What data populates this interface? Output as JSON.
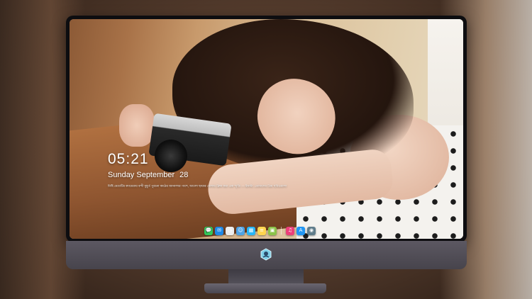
{
  "lockscreen": {
    "time": "05:21",
    "date_weekday_month": "Sunday September",
    "date_day": "28",
    "caption": "মিষ্টি মেয়েটির ক্যামেরায় বন্দী মুহূর্ত পুরনো কাঠের জানালার পাশে, আলো ছায়ার খেলায় ক্লিক করা এক স্মৃতি — ইনস্টা: তোমাদের প্রিয় ছবিওয়ালা"
  },
  "dock": {
    "items": [
      {
        "name": "messages-icon",
        "glyph": "💬",
        "color": "#34c759"
      },
      {
        "name": "mail-icon",
        "glyph": "✉",
        "color": "#1e88e5"
      },
      {
        "name": "clock-icon",
        "glyph": "◷",
        "color": "#ececec"
      },
      {
        "name": "finder-icon",
        "glyph": "☺",
        "color": "#4fa3e3"
      },
      {
        "name": "claquette-icon",
        "glyph": "▦",
        "color": "#29b6f6"
      },
      {
        "name": "notes-icon",
        "glyph": "≡",
        "color": "#ffd54f"
      },
      {
        "name": "preview-icon",
        "glyph": "▣",
        "color": "#8bc34a"
      },
      {
        "name": "music-icon",
        "glyph": "♫",
        "color": "#ec407a"
      },
      {
        "name": "app-store-icon",
        "glyph": "A",
        "color": "#2196f3"
      },
      {
        "name": "screenshot-icon",
        "glyph": "◉",
        "color": "#607d8b"
      }
    ]
  },
  "colors": {
    "frame": "#0d0d10",
    "chin": "#4f4c55"
  }
}
